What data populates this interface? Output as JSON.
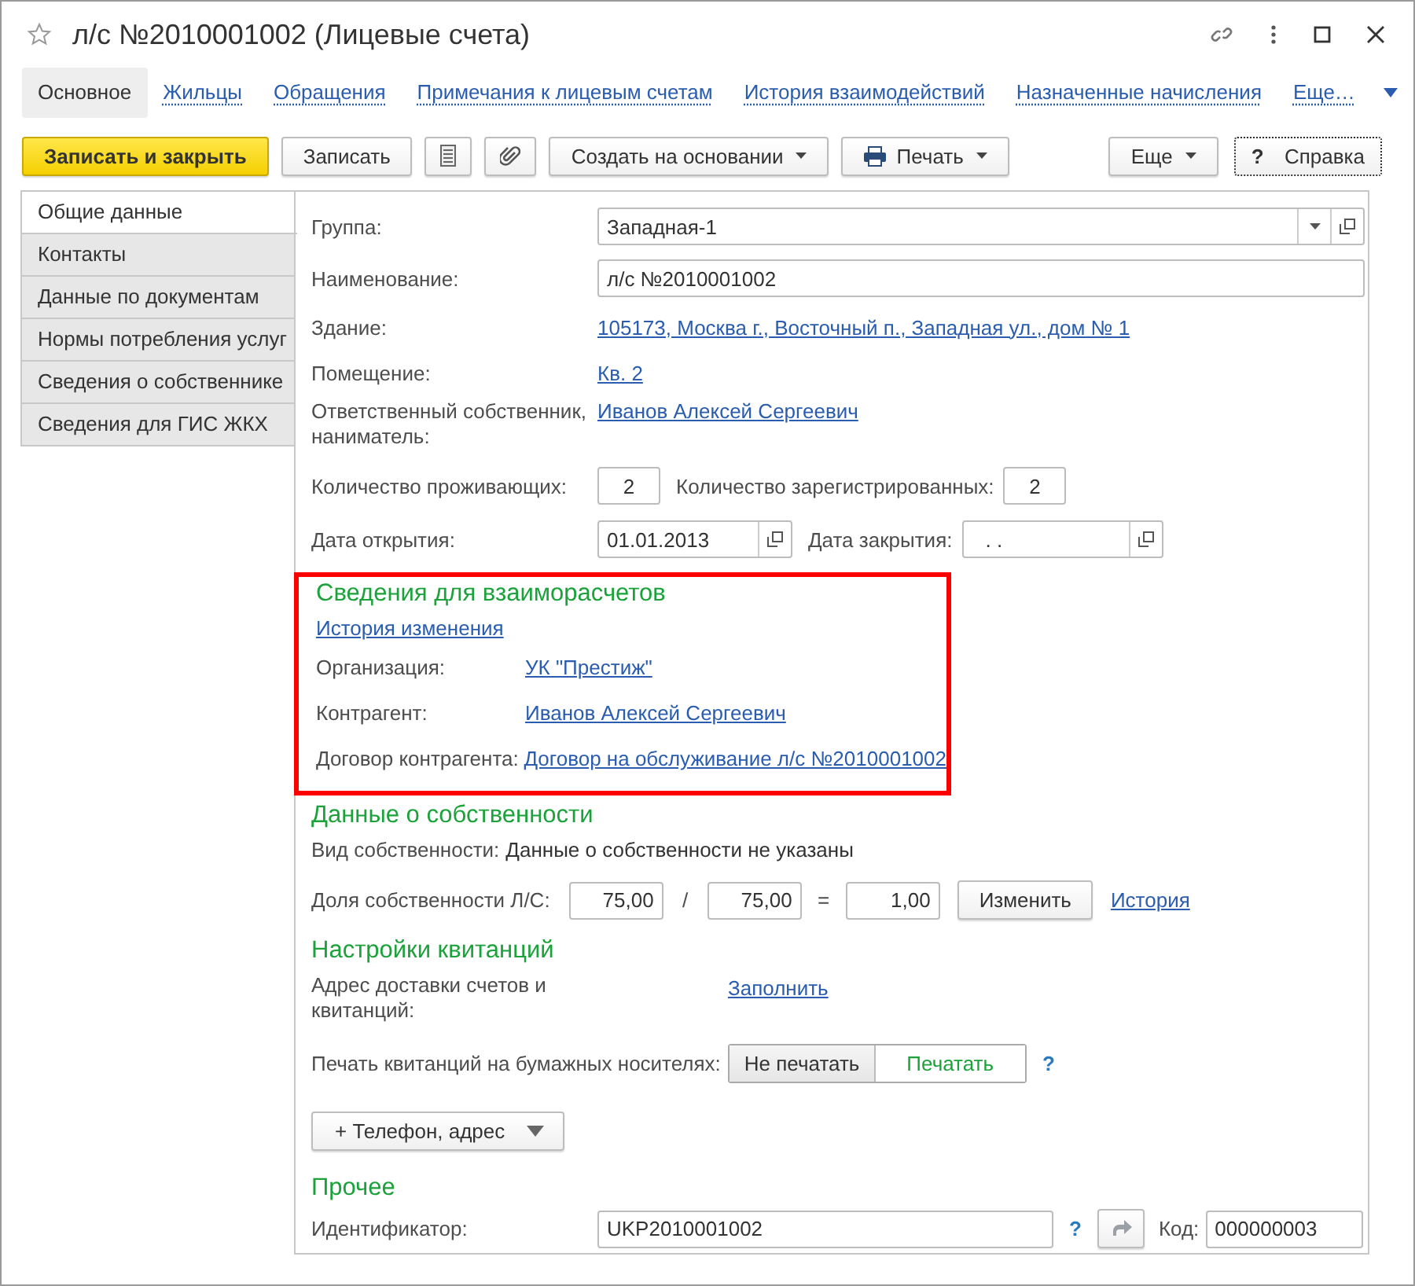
{
  "window": {
    "title": "л/с №2010001002 (Лицевые счета)",
    "favorite": false
  },
  "nav_tabs": [
    {
      "label": "Основное",
      "selected": true
    },
    {
      "label": "Жильцы",
      "selected": false
    },
    {
      "label": "Обращения",
      "selected": false
    },
    {
      "label": "Примечания к лицевым счетам",
      "selected": false
    },
    {
      "label": "История взаимодействий",
      "selected": false
    },
    {
      "label": "Назначенные начисления",
      "selected": false
    },
    {
      "label": "Еще…",
      "selected": false,
      "kind": "more"
    }
  ],
  "toolbar": [
    {
      "kind": "primary",
      "label": "Записать и закрыть"
    },
    {
      "kind": "plain",
      "label": "Записать"
    },
    {
      "kind": "list"
    },
    {
      "kind": "attach"
    },
    {
      "kind": "dropdown",
      "label": "Создать на основании"
    },
    {
      "kind": "print",
      "label": "Печать"
    }
  ],
  "toolbar_right": [
    {
      "kind": "dropdown",
      "label": "Еще"
    },
    {
      "kind": "help",
      "mark": "?",
      "label": "Справка"
    }
  ],
  "side_tabs": [
    {
      "label": "Общие данные",
      "selected": true
    },
    {
      "label": "Контакты",
      "selected": false
    },
    {
      "label": "Данные по документам",
      "selected": false
    },
    {
      "label": "Нормы потребления услуг",
      "selected": false
    },
    {
      "label": "Сведения о собственнике",
      "selected": false
    },
    {
      "label": "Сведения для ГИС ЖКХ",
      "selected": false
    }
  ],
  "group": {
    "label": "Группа:",
    "value": "Западная-1"
  },
  "name": {
    "label": "Наименование:",
    "value": "л/с №2010001002"
  },
  "building": {
    "label": "Здание:",
    "link": "105173, Москва г., Восточный п., Западная ул., дом № 1"
  },
  "premises": {
    "label": "Помещение:",
    "link": "Кв. 2"
  },
  "responsible": {
    "label": "Ответственный собственник, наниматель:",
    "link": "Иванов Алексей Сергеевич"
  },
  "residents": {
    "label": "Количество проживающих:",
    "value": "2"
  },
  "registered": {
    "label": "Количество зарегистрированных:",
    "value": "2"
  },
  "open_date": {
    "label": "Дата открытия:",
    "value": "01.01.2013"
  },
  "close_date": {
    "label": "Дата закрытия:",
    "value": ".  ."
  },
  "settlements": {
    "title": "Сведения для взаиморасчетов",
    "highlighted": true,
    "history_link": "История изменения",
    "rows": [
      {
        "label": "Организация:",
        "link": "УК \"Престиж\""
      },
      {
        "label": "Контрагент:",
        "link": "Иванов Алексей Сергеевич"
      },
      {
        "label": "Договор контрагента:",
        "link": "Договор на обслуживание л/с №2010001002"
      }
    ]
  },
  "ownership": {
    "title": "Данные о собственности",
    "kind_label": "Вид собственности:",
    "kind_value": "Данные о собственности не указаны",
    "share_label": "Доля собственности Л/С:",
    "numerator": "75,00",
    "slash": "/",
    "denominator": "75,00",
    "equals": "=",
    "result": "1,00",
    "change_button": "Изменить",
    "history_link": "История"
  },
  "receipts": {
    "title": "Настройки квитанций",
    "address_label": "Адрес доставки счетов и квитанций:",
    "fill_link": "Заполнить",
    "print_label": "Печать квитанций на бумажных носителях:",
    "print_options": [
      {
        "label": "Не печатать",
        "selected": false
      },
      {
        "label": "Печатать",
        "selected": true
      }
    ],
    "help": "?"
  },
  "contact_button": "+ Телефон, адрес",
  "other": {
    "title": "Прочее",
    "id_label": "Идентификатор:",
    "id_value": "UKP2010001002",
    "help": "?",
    "code_label": "Код:",
    "code_value": "000000003"
  }
}
